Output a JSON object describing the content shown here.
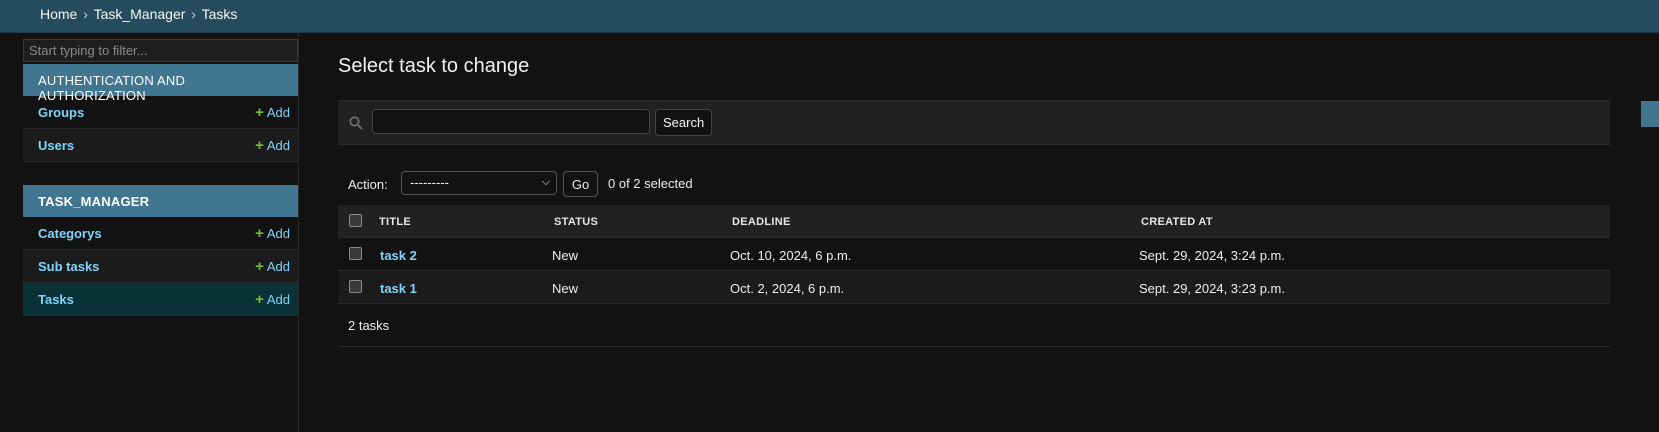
{
  "breadcrumb": {
    "items": [
      "Home",
      "Task_Manager",
      "Tasks"
    ],
    "separator": "›"
  },
  "sidebar": {
    "filter_placeholder": "Start typing to filter...",
    "modules": [
      {
        "caption": "AUTHENTICATION AND AUTHORIZATION",
        "models": [
          {
            "name": "Groups",
            "add": "Add"
          },
          {
            "name": "Users",
            "add": "Add"
          }
        ]
      },
      {
        "caption": "TASK_MANAGER",
        "models": [
          {
            "name": "Categorys",
            "add": "Add"
          },
          {
            "name": "Sub tasks",
            "add": "Add"
          },
          {
            "name": "Tasks",
            "add": "Add"
          }
        ]
      }
    ]
  },
  "main": {
    "title": "Select task to change",
    "search_button": "Search",
    "search_value": "",
    "action_label": "Action:",
    "action_selected": "---------",
    "go_button": "Go",
    "selected_count": "0 of 2 selected",
    "columns": [
      "TITLE",
      "STATUS",
      "DEADLINE",
      "CREATED AT"
    ],
    "rows": [
      {
        "title": "task 2",
        "status": "New",
        "deadline": "Oct. 10, 2024, 6 p.m.",
        "created_at": "Sept. 29, 2024, 3:24 p.m."
      },
      {
        "title": "task 1",
        "status": "New",
        "deadline": "Oct. 2, 2024, 6 p.m.",
        "created_at": "Sept. 29, 2024, 3:23 p.m."
      }
    ],
    "result_count": "2 tasks"
  },
  "colors": {
    "header": "#264b5d",
    "module_caption": "#417690",
    "link": "#81d4fa",
    "add_plus": "#70bf2b",
    "active_row": "#0a3236"
  },
  "icons": {
    "search": "search-icon",
    "add": "plus-icon",
    "dropdown": "chevron-down-icon"
  }
}
